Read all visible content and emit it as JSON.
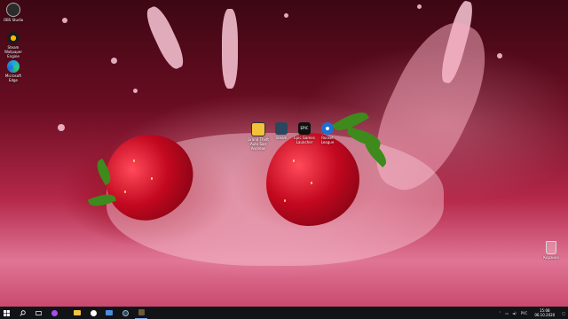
{
  "desktop": {
    "icons_left": [
      {
        "label": "OBS Studio",
        "icon": "obs-icon",
        "color": "#2b2b2b"
      },
      {
        "label": "Steam Wallpaper Engine",
        "icon": "wallpaper-engine-icon",
        "color": "#1b1b1b"
      },
      {
        "label": "Microsoft Edge",
        "icon": "edge-icon",
        "color": "#1ea5e8"
      }
    ],
    "icons_center": [
      {
        "label": "Grand Theft Auto San Andreas",
        "icon": "gta-sa-icon",
        "color": "#f2c23a"
      },
      {
        "label": "Steam",
        "icon": "steam-icon",
        "color": "#2a475e"
      },
      {
        "label": "Epic Games Launcher",
        "icon": "epic-games-icon",
        "color": "#111111",
        "text": "EPIC"
      },
      {
        "label": "Rocket League",
        "icon": "rocket-league-icon",
        "color": "#1f6fd1"
      }
    ],
    "recycle_bin": {
      "label": "Корзина",
      "icon": "recycle-bin-icon"
    }
  },
  "taskbar": {
    "pinned": [
      {
        "name": "start",
        "icon": "windows-start-icon"
      },
      {
        "name": "search",
        "icon": "search-icon"
      },
      {
        "name": "task-view",
        "icon": "task-view-icon"
      },
      {
        "name": "cortana",
        "icon": "cortana-icon"
      },
      {
        "name": "file-explorer",
        "icon": "folder-icon"
      },
      {
        "name": "yandex",
        "icon": "yandex-browser-icon"
      },
      {
        "name": "mail",
        "icon": "mail-icon"
      },
      {
        "name": "steam",
        "icon": "steam-icon"
      },
      {
        "name": "game",
        "icon": "game-controller-icon"
      }
    ],
    "tray": {
      "language": "РУС",
      "time": "15:08",
      "date": "06.10.2020"
    }
  }
}
